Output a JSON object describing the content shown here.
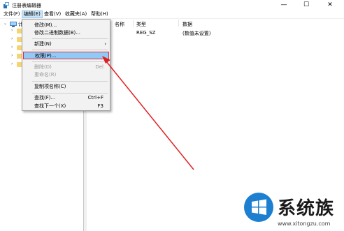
{
  "window": {
    "title": "注册表编辑器",
    "controls": {
      "minimize": "—",
      "maximize": "☐",
      "close": "✕"
    }
  },
  "menubar": {
    "items": [
      "文件(F)",
      "编辑(E)",
      "查看(V)",
      "收藏夹(A)",
      "帮助(H)"
    ],
    "active_index": 1
  },
  "tree": {
    "root_label": "计",
    "root_icon": "computer-icon",
    "child_icon": "folder-icon"
  },
  "list": {
    "columns": [
      "名称",
      "类型",
      "数据"
    ],
    "rows": [
      {
        "type": "REG_SZ",
        "data": "(数值未设置)"
      }
    ]
  },
  "context_menu": {
    "items": [
      {
        "label": "修改(M)...",
        "shortcut": "",
        "disabled": false
      },
      {
        "label": "修改二进制数据(B)...",
        "shortcut": "",
        "disabled": false
      },
      {
        "label": "新建(N)",
        "shortcut": "",
        "disabled": false,
        "submenu": "›"
      },
      {
        "label": "权限(P)...",
        "shortcut": "",
        "disabled": false,
        "highlighted": true
      },
      {
        "label": "删除(D)",
        "shortcut": "Del",
        "disabled": true
      },
      {
        "label": "重命名(R)",
        "shortcut": "",
        "disabled": true
      },
      {
        "label": "复制项名称(C)",
        "shortcut": "",
        "disabled": false
      },
      {
        "label": "查找(F)...",
        "shortcut": "Ctrl+F",
        "disabled": false
      },
      {
        "label": "查找下一个(X)",
        "shortcut": "F3",
        "disabled": false
      }
    ]
  },
  "annotation": {
    "color": "#e02020"
  },
  "watermark": {
    "text": "系统族",
    "url": "www.xitongzu.com",
    "logo_color": "#1c7fd0"
  },
  "colors": {
    "highlight_bg": "#91c9f7",
    "highlight_border": "#e0303a",
    "menu_active_bg": "#cce4f7"
  }
}
